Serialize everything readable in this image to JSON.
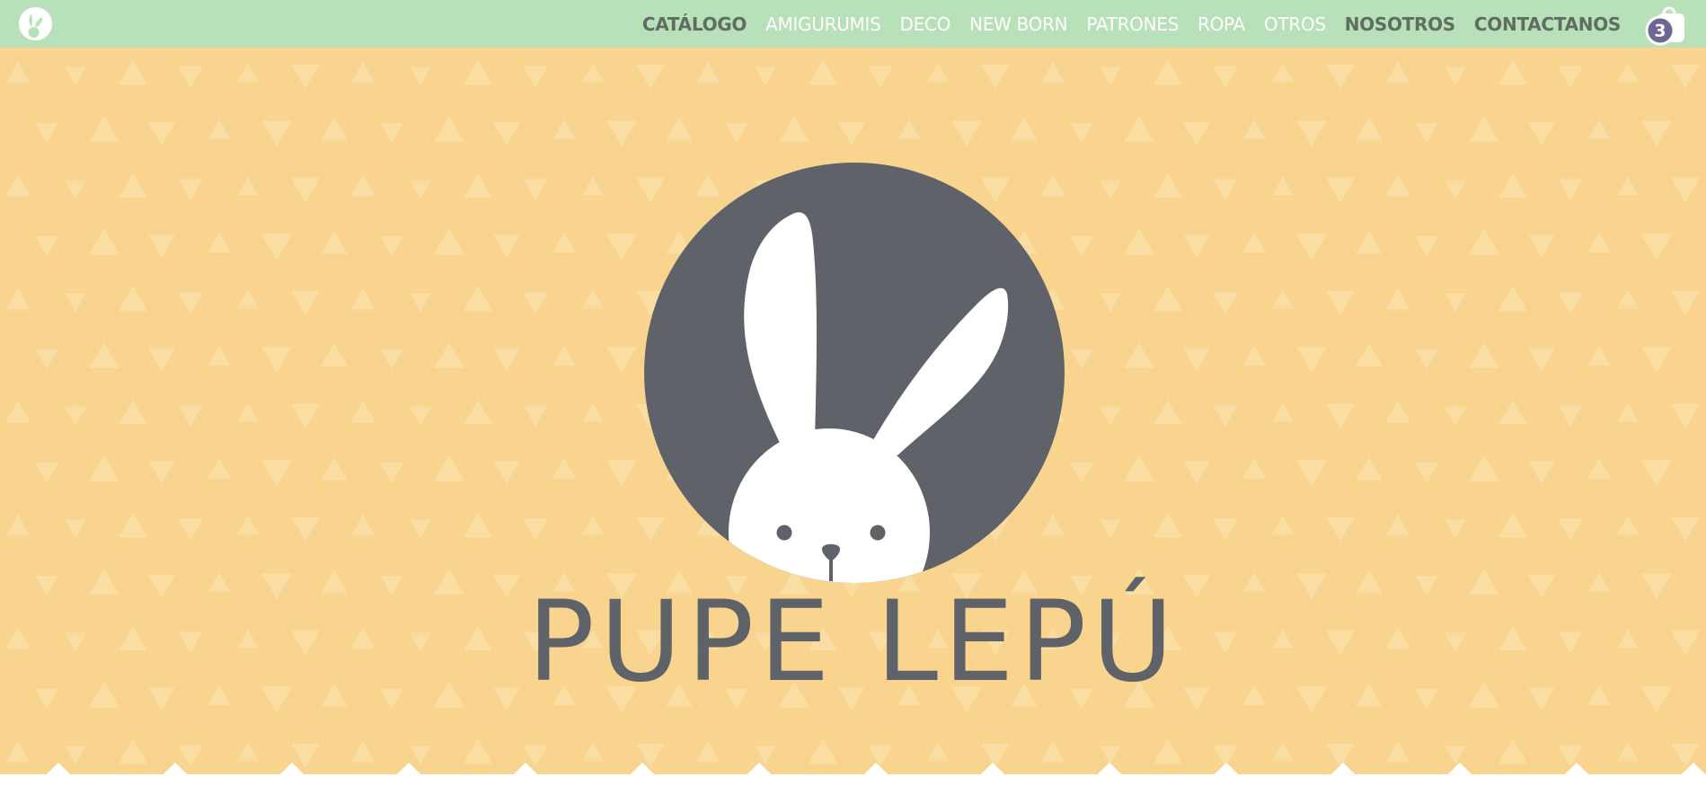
{
  "brand": {
    "name": "PUPE LEPÚ",
    "logo_icon": "bunny-logo-icon",
    "emblem_icon": "bunny-emblem-icon"
  },
  "nav": {
    "items": [
      {
        "label": "CATÁLOGO",
        "bold": true
      },
      {
        "label": "AMIGURUMIS",
        "bold": false
      },
      {
        "label": "DECO",
        "bold": false
      },
      {
        "label": "NEW BORN",
        "bold": false
      },
      {
        "label": "PATRONES",
        "bold": false
      },
      {
        "label": "ROPA",
        "bold": false
      },
      {
        "label": "OTROS",
        "bold": false
      },
      {
        "label": "NOSOTROS",
        "bold": true
      },
      {
        "label": "CONTACTANOS",
        "bold": true
      }
    ]
  },
  "cart": {
    "icon": "shopping-bag-icon",
    "count": "3"
  },
  "colors": {
    "nav_background": "#b8e0b9",
    "hero_background": "#f8d48e",
    "emblem": "#5f6369",
    "nav_bold_text": "#5f6d63",
    "cart_badge": "#6e6794"
  }
}
